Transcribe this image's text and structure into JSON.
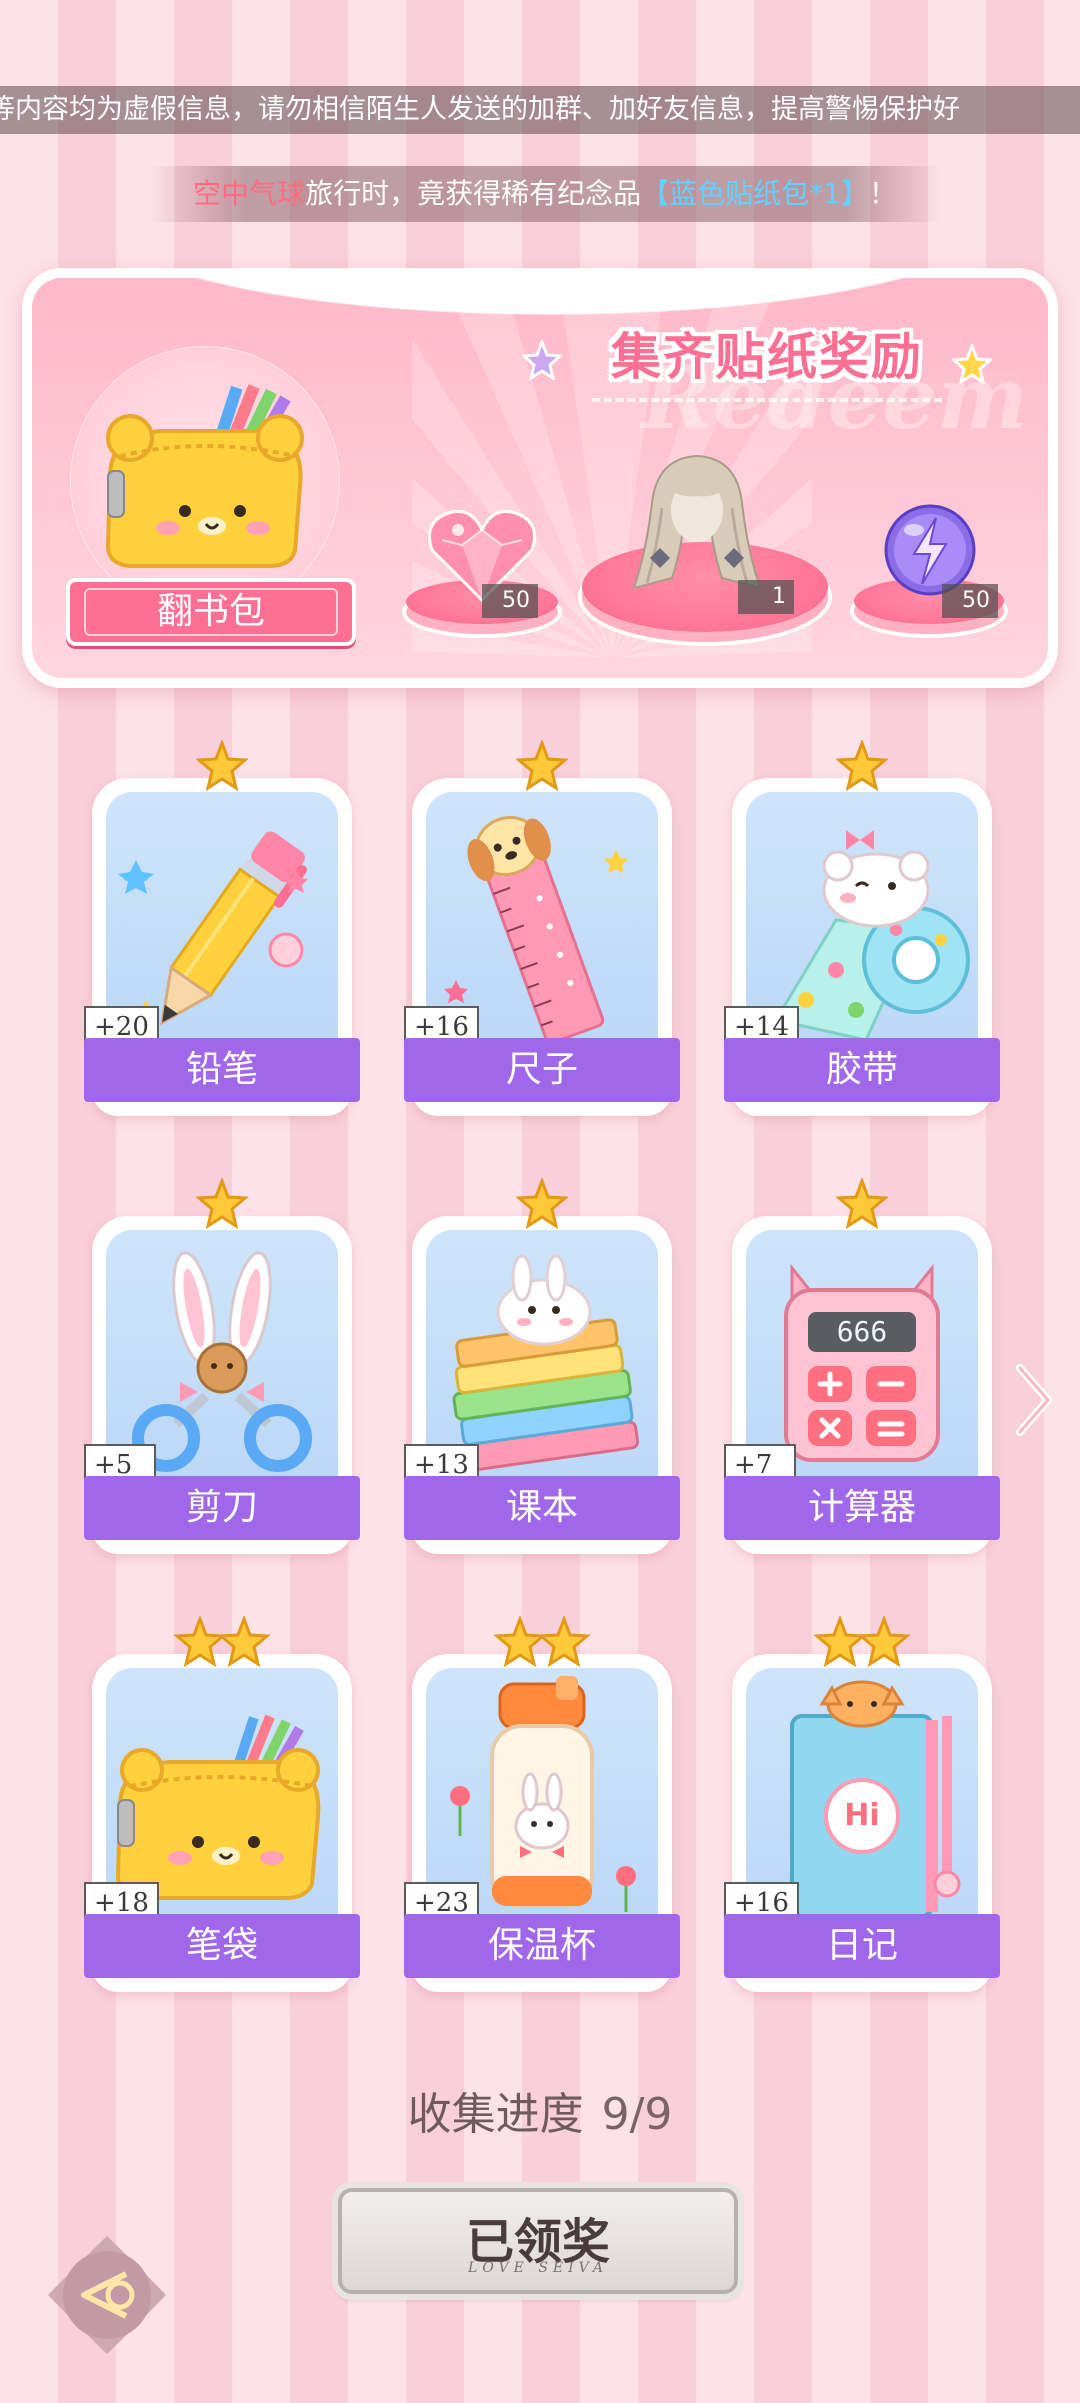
{
  "marquee": {
    "text": "等内容均为虚假信息，请勿相信陌生人发送的加群、加好友信息，提高警惕保护好"
  },
  "notice": {
    "player_name": "空中气球",
    "middle": "旅行时，竟获得稀有纪念品",
    "item": "【蓝色贴纸包*1】",
    "end": "！"
  },
  "reward_panel": {
    "title": "集齐贴纸奖励",
    "watermark": "Redeem",
    "bag_label": "翻书包",
    "rewards": [
      {
        "icon": "pink-heart-gem-icon",
        "count": "50"
      },
      {
        "icon": "hair-accessory-icon",
        "count": "1"
      },
      {
        "icon": "purple-lightning-orb-icon",
        "count": "50"
      }
    ]
  },
  "stickers": [
    {
      "name": "铅笔",
      "plus": "+20",
      "stars": 1,
      "icon": "pencil-icon"
    },
    {
      "name": "尺子",
      "plus": "+16",
      "stars": 1,
      "icon": "ruler-icon"
    },
    {
      "name": "胶带",
      "plus": "+14",
      "stars": 1,
      "icon": "tape-icon"
    },
    {
      "name": "剪刀",
      "plus": "+5",
      "stars": 1,
      "icon": "scissors-icon"
    },
    {
      "name": "课本",
      "plus": "+13",
      "stars": 1,
      "icon": "textbook-icon"
    },
    {
      "name": "计算器",
      "plus": "+7",
      "stars": 1,
      "icon": "calculator-icon"
    },
    {
      "name": "笔袋",
      "plus": "+18",
      "stars": 2,
      "icon": "pencil-case-icon"
    },
    {
      "name": "保温杯",
      "plus": "+23",
      "stars": 2,
      "icon": "thermos-icon"
    },
    {
      "name": "日记",
      "plus": "+16",
      "stars": 2,
      "icon": "diary-icon"
    }
  ],
  "calculator_display": "666",
  "diary_text": "Hi",
  "progress": {
    "label": "收集进度",
    "value": "9/9",
    "done": 9,
    "total": 9
  },
  "claim_button": {
    "label": "已领奖",
    "sub": "LOVE SEIVA"
  },
  "colors": {
    "accent": "#ff6f93",
    "label_bg": "#a167ea",
    "card_bg": "#cfe4fb",
    "stripe_a": "#fde2e8",
    "stripe_b": "#f9cfd9"
  }
}
